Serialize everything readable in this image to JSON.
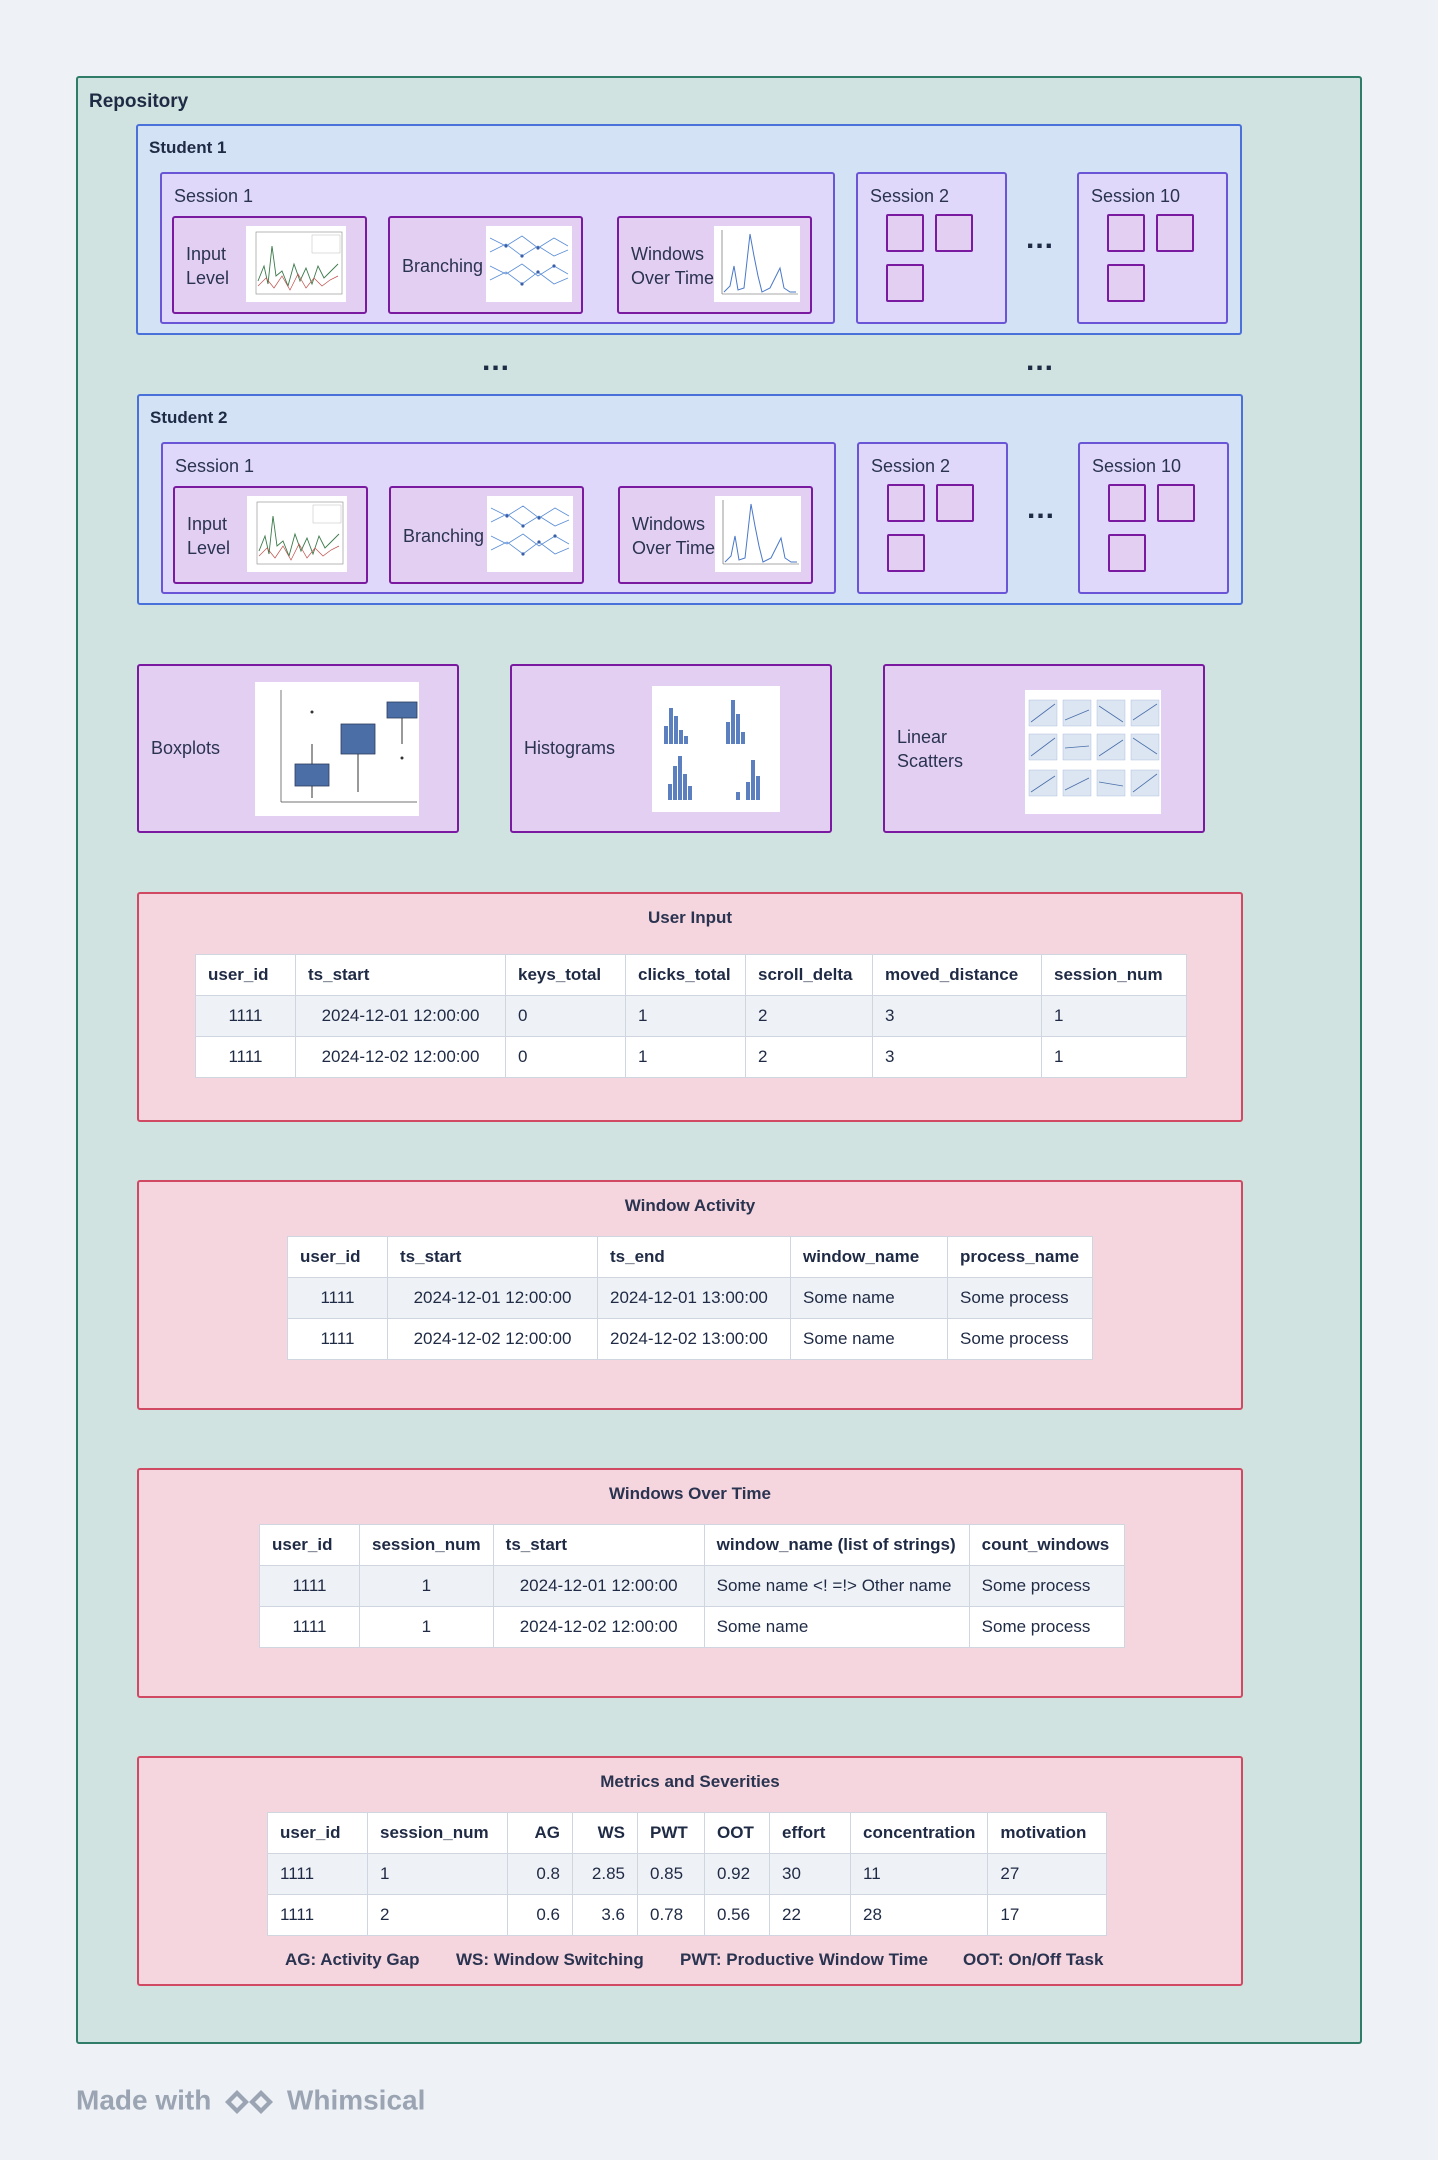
{
  "repository": {
    "title": "Repository"
  },
  "students": [
    {
      "title": "Student 1",
      "session1": {
        "title": "Session 1",
        "cards": {
          "input_level": "Input Level",
          "branching": "Branching",
          "windows_over_time": "Windows Over Time"
        }
      },
      "session2": {
        "title": "Session 2"
      },
      "session10": {
        "title": "Session 10"
      },
      "ellipsis": "..."
    },
    {
      "title": "Student 2",
      "session1": {
        "title": "Session 1",
        "cards": {
          "input_level": "Input Level",
          "branching": "Branching",
          "windows_over_time": "Windows Over Time"
        }
      },
      "session2": {
        "title": "Session 2"
      },
      "session10": {
        "title": "Session 10"
      },
      "ellipsis": "..."
    }
  ],
  "between_students_ellipsis": [
    "...",
    "..."
  ],
  "plots": {
    "boxplots": "Boxplots",
    "histograms": "Histograms",
    "linear_scatters": "Linear Scatters"
  },
  "tables": {
    "user_input": {
      "title": "User Input",
      "headers": [
        "user_id",
        "ts_start",
        "keys_total",
        "clicks_total",
        "scroll_delta",
        "moved_distance",
        "session_num"
      ],
      "rows": [
        [
          "1111",
          "2024-12-01 12:00:00",
          "0",
          "1",
          "2",
          "3",
          "1"
        ],
        [
          "1111",
          "2024-12-02 12:00:00",
          "0",
          "1",
          "2",
          "3",
          "1"
        ]
      ]
    },
    "window_activity": {
      "title": "Window Activity",
      "headers": [
        "user_id",
        "ts_start",
        "ts_end",
        "window_name",
        "process_name"
      ],
      "rows": [
        [
          "1111",
          "2024-12-01 12:00:00",
          "2024-12-01 13:00:00",
          "Some name",
          "Some process"
        ],
        [
          "1111",
          "2024-12-02 12:00:00",
          "2024-12-02 13:00:00",
          "Some name",
          "Some process"
        ]
      ]
    },
    "windows_over_time": {
      "title": "Windows Over Time",
      "headers": [
        "user_id",
        "session_num",
        "ts_start",
        "window_name (list of strings)",
        "count_windows"
      ],
      "rows": [
        [
          "1111",
          "1",
          "2024-12-01 12:00:00",
          "Some name <! =!> Other name",
          "Some process"
        ],
        [
          "1111",
          "1",
          "2024-12-02 12:00:00",
          "Some name",
          "Some process"
        ]
      ]
    },
    "metrics": {
      "title": "Metrics and Severities",
      "headers": [
        "user_id",
        "session_num",
        "AG",
        "WS",
        "PWT",
        "OOT",
        "effort",
        "concentration",
        "motivation"
      ],
      "rows": [
        [
          "1111",
          "1",
          "0.8",
          "2.85",
          "0.85",
          "0.92",
          "30",
          "11",
          "27"
        ],
        [
          "1111",
          "2",
          "0.6",
          "3.6",
          "0.78",
          "0.56",
          "22",
          "28",
          "17"
        ]
      ],
      "legend": [
        "AG: Activity Gap",
        "WS: Window Switching",
        "PWT: Productive Window Time",
        "OOT: On/Off Task"
      ]
    }
  },
  "footer": {
    "made_with": "Made with",
    "brand": "Whimsical"
  }
}
